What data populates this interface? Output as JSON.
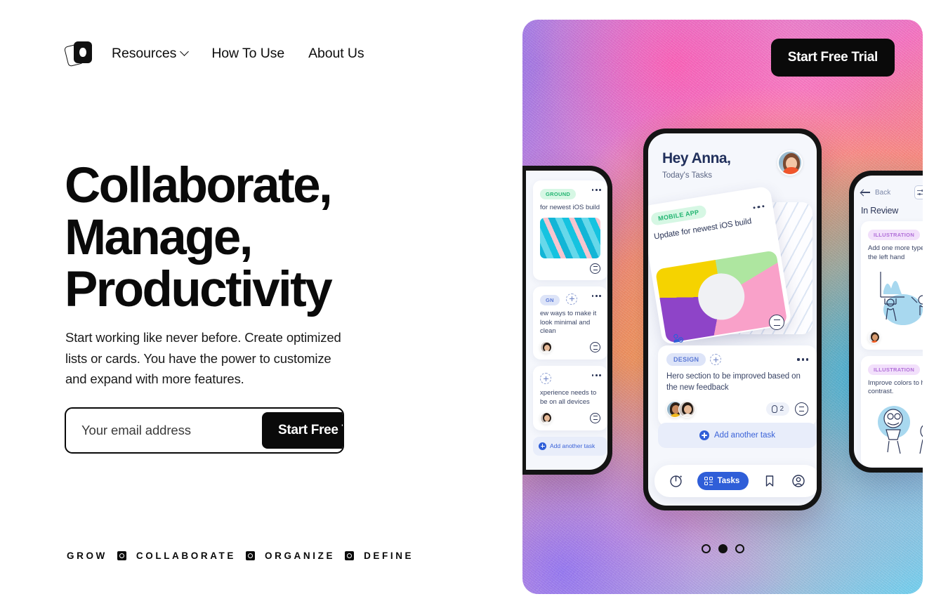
{
  "brand": {
    "logo_name": "stacked-cards-logo"
  },
  "nav": {
    "items": [
      {
        "label": "Resources",
        "has_dropdown": true
      },
      {
        "label": "How To Use",
        "has_dropdown": false
      },
      {
        "label": "About Us",
        "has_dropdown": false
      }
    ]
  },
  "hero": {
    "headline_line1": "Collaborate,",
    "headline_line2": "Manage,",
    "headline_line3": "Productivity",
    "subcopy": "Start working like never before. Create optimized lists or cards. You have the power to customize and expand with more features.",
    "email_placeholder": "Your email address",
    "email_value": "",
    "cta_label": "Start Free Trial",
    "overlay_cta_label": "Start Free Trial"
  },
  "tagline": {
    "words": [
      "GROW",
      "COLLABORATE",
      "ORGANIZE",
      "DEFINE"
    ],
    "separator_name": "square-bullseye-separator"
  },
  "colors": {
    "ink": "#0a0a0a",
    "accent_blue": "#2f5ed8",
    "badge_green_bg": "#d6f7e4",
    "badge_green_text": "#23b572",
    "badge_blue_bg": "#dde4f8",
    "badge_blue_text": "#5b79d6",
    "badge_pink_bg": "#f2e0fb",
    "badge_pink_text": "#b06ed8"
  },
  "app_preview": {
    "center_phone": {
      "greeting": "Hey Anna,",
      "subtitle": "Today's Tasks",
      "featured_card": {
        "badge": "MOBILE APP",
        "title": "Update for newest iOS build",
        "chart_colors": [
          "#8e44c8",
          "#f5d300",
          "#aee6a0",
          "#f9a1c9"
        ]
      },
      "task_card": {
        "badge": "DESIGN",
        "text": "Hero section to be improved based on the new feedback",
        "attachment_count": "2"
      },
      "add_task_label": "Add another task",
      "tabbar": {
        "items": [
          {
            "name": "stats-icon",
            "label": "",
            "active": false
          },
          {
            "name": "tasks-icon",
            "label": "Tasks",
            "active": true
          },
          {
            "name": "bookmark-icon",
            "label": "",
            "active": false
          },
          {
            "name": "profile-icon",
            "label": "",
            "active": false
          }
        ]
      }
    },
    "left_phone": {
      "cards": [
        {
          "badge": "GROUND",
          "text": "for newest iOS build",
          "has_image": true
        },
        {
          "badge": "GN",
          "text": "ew ways to make it look minimal and clean",
          "has_image": false
        },
        {
          "badge": "",
          "text": "xperience needs to be on all devices",
          "has_image": false
        }
      ],
      "add_task_label": "Add another task"
    },
    "right_phone": {
      "back_label": "Back",
      "title": "In Review",
      "cards": [
        {
          "badge": "ILLUSTRATION",
          "text": "Add one more type the left hand"
        },
        {
          "badge": "ILLUSTRATION",
          "text": "Improve colors to h contrast."
        }
      ]
    },
    "carousel": {
      "total": 3,
      "active_index": 1
    }
  }
}
